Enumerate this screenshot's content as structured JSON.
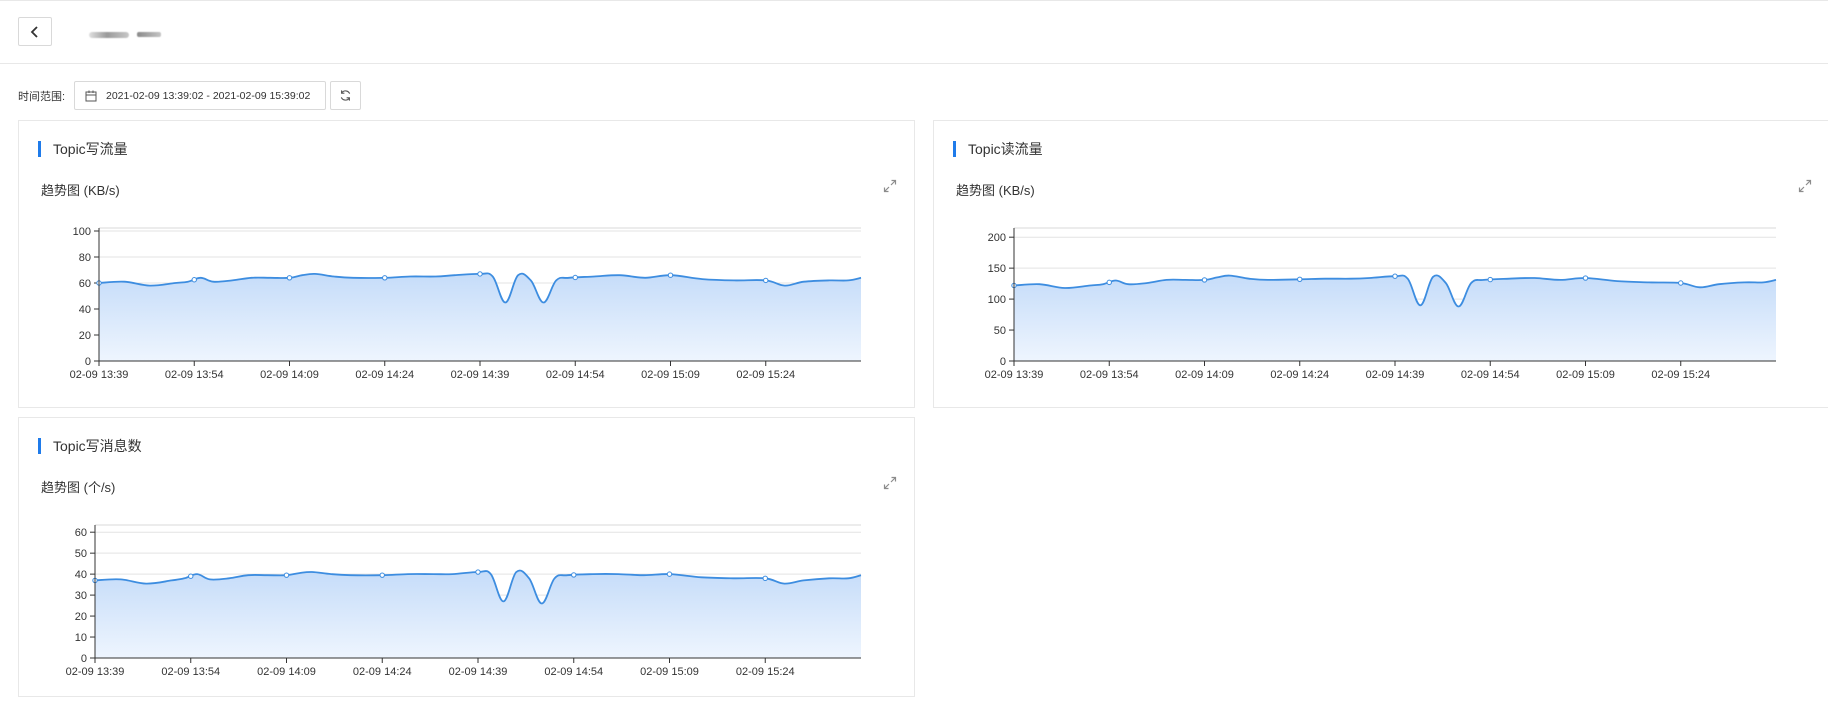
{
  "header": {
    "back_icon": "chevron-left-icon"
  },
  "filter": {
    "label": "时间范围:",
    "range_value": "2021-02-09 13:39:02 - 2021-02-09 15:39:02",
    "calendar_icon": "calendar-icon",
    "refresh_icon": "refresh-icon"
  },
  "cards": [
    {
      "title": "Topic写流量",
      "subtitle": "趋势图 (KB/s)"
    },
    {
      "title": "Topic读流量",
      "subtitle": "趋势图 (KB/s)"
    },
    {
      "title": "Topic写消息数",
      "subtitle": "趋势图 (个/s)"
    }
  ],
  "colors": {
    "accent": "#1f7bea",
    "line": "#3d8de0",
    "area_top": "#c5dcf9",
    "area_bottom": "#eef5fe"
  },
  "chart_data": [
    {
      "type": "area",
      "x_ticks": [
        "02-09 13:39",
        "02-09 13:54",
        "02-09 14:09",
        "02-09 14:24",
        "02-09 14:39",
        "02-09 14:54",
        "02-09 15:09",
        "02-09 15:24"
      ],
      "ylim": [
        0,
        100
      ],
      "y_ticks": [
        0,
        20,
        40,
        60,
        80,
        100
      ],
      "x_range_minutes": [
        0,
        120
      ],
      "grid": true,
      "series": [
        {
          "points": [
            [
              0,
              60
            ],
            [
              4,
              61
            ],
            [
              8,
              58
            ],
            [
              12,
              60
            ],
            [
              14,
              61
            ],
            [
              16,
              64
            ],
            [
              18,
              61
            ],
            [
              21,
              62
            ],
            [
              24,
              64
            ],
            [
              27,
              64
            ],
            [
              30,
              64
            ],
            [
              32,
              66
            ],
            [
              34,
              67
            ],
            [
              37,
              65
            ],
            [
              40,
              64
            ],
            [
              45,
              64
            ],
            [
              49,
              65
            ],
            [
              53,
              65
            ],
            [
              56,
              66
            ],
            [
              60,
              67
            ],
            [
              62,
              65
            ],
            [
              64,
              45
            ],
            [
              66,
              66
            ],
            [
              68,
              62
            ],
            [
              70,
              45
            ],
            [
              72,
              62
            ],
            [
              74,
              64
            ],
            [
              78,
              65
            ],
            [
              82,
              66
            ],
            [
              86,
              64
            ],
            [
              90,
              66
            ],
            [
              95,
              63
            ],
            [
              100,
              62
            ],
            [
              105,
              62
            ],
            [
              108,
              58
            ],
            [
              111,
              61
            ],
            [
              115,
              62
            ],
            [
              118,
              62
            ],
            [
              120,
              64
            ]
          ],
          "markers": [
            0,
            15,
            30,
            45,
            60,
            75,
            90,
            105
          ]
        }
      ]
    },
    {
      "type": "area",
      "x_ticks": [
        "02-09 13:39",
        "02-09 13:54",
        "02-09 14:09",
        "02-09 14:24",
        "02-09 14:39",
        "02-09 14:54",
        "02-09 15:09",
        "02-09 15:24"
      ],
      "ylim": [
        0,
        210
      ],
      "y_ticks": [
        0,
        50,
        100,
        150,
        200
      ],
      "x_range_minutes": [
        0,
        120
      ],
      "grid": true,
      "series": [
        {
          "points": [
            [
              0,
              122
            ],
            [
              4,
              124
            ],
            [
              8,
              118
            ],
            [
              12,
              122
            ],
            [
              14,
              124
            ],
            [
              16,
              130
            ],
            [
              18,
              124
            ],
            [
              21,
              126
            ],
            [
              24,
              131
            ],
            [
              27,
              131
            ],
            [
              30,
              131
            ],
            [
              32,
              135
            ],
            [
              34,
              138
            ],
            [
              37,
              133
            ],
            [
              40,
              131
            ],
            [
              45,
              132
            ],
            [
              49,
              133
            ],
            [
              53,
              133
            ],
            [
              56,
              134
            ],
            [
              60,
              137
            ],
            [
              62,
              133
            ],
            [
              64,
              90
            ],
            [
              66,
              136
            ],
            [
              68,
              126
            ],
            [
              70,
              88
            ],
            [
              72,
              126
            ],
            [
              74,
              131
            ],
            [
              78,
              133
            ],
            [
              82,
              134
            ],
            [
              86,
              131
            ],
            [
              90,
              134
            ],
            [
              95,
              129
            ],
            [
              100,
              127
            ],
            [
              105,
              126
            ],
            [
              108,
              119
            ],
            [
              111,
              124
            ],
            [
              115,
              127
            ],
            [
              118,
              127
            ],
            [
              120,
              131
            ]
          ],
          "markers": [
            0,
            15,
            30,
            45,
            60,
            75,
            90,
            105
          ]
        }
      ]
    },
    {
      "type": "area",
      "x_ticks": [
        "02-09 13:39",
        "02-09 13:54",
        "02-09 14:09",
        "02-09 14:24",
        "02-09 14:39",
        "02-09 14:54",
        "02-09 15:09",
        "02-09 15:24"
      ],
      "ylim": [
        0,
        62
      ],
      "y_ticks": [
        0,
        10,
        20,
        30,
        40,
        50,
        60
      ],
      "x_range_minutes": [
        0,
        120
      ],
      "grid": true,
      "series": [
        {
          "points": [
            [
              0,
              37
            ],
            [
              4,
              37.5
            ],
            [
              8,
              35.5
            ],
            [
              12,
              37
            ],
            [
              14,
              38
            ],
            [
              16,
              40
            ],
            [
              18,
              37.5
            ],
            [
              21,
              38
            ],
            [
              24,
              39.5
            ],
            [
              27,
              39.5
            ],
            [
              30,
              39.5
            ],
            [
              32,
              40.5
            ],
            [
              34,
              41
            ],
            [
              37,
              40
            ],
            [
              40,
              39.5
            ],
            [
              45,
              39.5
            ],
            [
              49,
              40
            ],
            [
              53,
              40
            ],
            [
              56,
              40
            ],
            [
              60,
              41
            ],
            [
              62,
              40
            ],
            [
              64,
              27
            ],
            [
              66,
              41
            ],
            [
              68,
              38
            ],
            [
              70,
              26
            ],
            [
              72,
              38
            ],
            [
              74,
              39.5
            ],
            [
              78,
              40
            ],
            [
              82,
              40
            ],
            [
              86,
              39.5
            ],
            [
              90,
              40
            ],
            [
              95,
              38.5
            ],
            [
              100,
              38
            ],
            [
              105,
              38
            ],
            [
              108,
              35.5
            ],
            [
              111,
              37
            ],
            [
              115,
              38
            ],
            [
              118,
              38
            ],
            [
              120,
              39.5
            ]
          ],
          "markers": [
            0,
            15,
            30,
            45,
            60,
            75,
            90,
            105
          ]
        }
      ]
    }
  ]
}
